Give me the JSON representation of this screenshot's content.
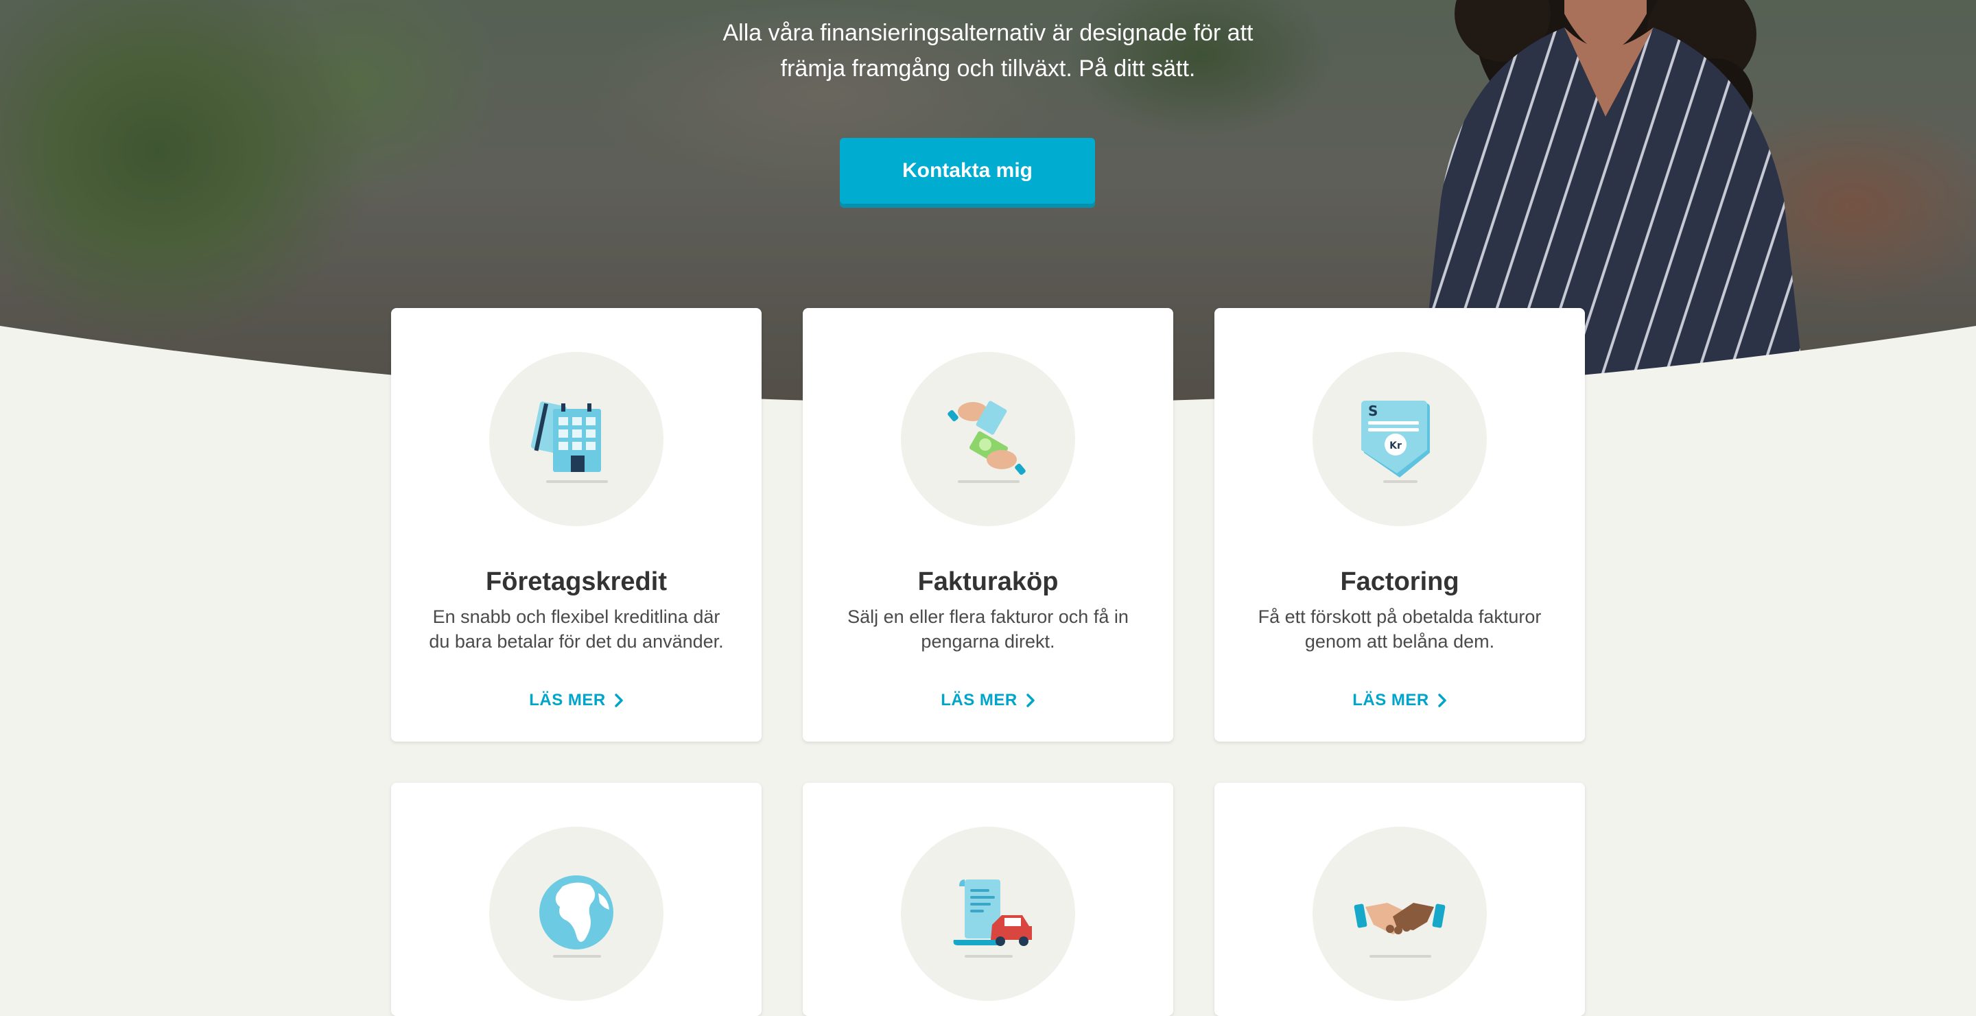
{
  "hero": {
    "line1": "Alla våra finansieringsalternativ är designade för att",
    "line2": "främja framgång och tillväxt. På ditt sätt.",
    "cta_label": "Kontakta mig"
  },
  "cards": [
    {
      "title": "Företagskredit",
      "desc_line1": "En snabb och flexibel kreditlina där",
      "desc_line2": "du bara betalar för det du använder.",
      "link": "LÄS MER",
      "icon": "building-card-icon"
    },
    {
      "title": "Fakturaköp",
      "desc_line1": "Sälj en eller flera fakturor och få in",
      "desc_line2": "pengarna direkt.",
      "link": "LÄS MER",
      "icon": "invoice-money-exchange-icon"
    },
    {
      "title": "Factoring",
      "desc_line1": "Få ett förskott på obetalda fakturor",
      "desc_line2": "genom att belåna dem.",
      "link": "LÄS MER",
      "icon": "invoice-kr-tag-icon"
    },
    {
      "icon": "globe-icon"
    },
    {
      "icon": "document-car-icon"
    },
    {
      "icon": "handshake-icon"
    }
  ],
  "colors": {
    "accent": "#00acd0",
    "background": "#f3f3ee",
    "card": "#ffffff",
    "title_text": "#333333"
  }
}
